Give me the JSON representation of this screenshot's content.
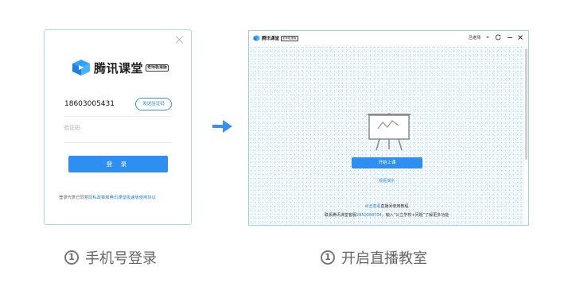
{
  "login_panel": {
    "brand": "腾讯课堂",
    "brand_badge": "老师极速版",
    "phone_value": "18603005431",
    "send_code_label": "发送验证码",
    "code_placeholder": "验证码",
    "login_label": "登 录",
    "agreement_prefix": "登录代表已同意",
    "agreement_link_privacy": "隐私政策",
    "agreement_and": "和",
    "agreement_link_terms": "腾讯课堂极速版使用协议"
  },
  "caption_left": {
    "number": "1",
    "text": "手机号登录"
  },
  "caption_right": {
    "number": "1",
    "text": "开启直播教室"
  },
  "classroom_window": {
    "title": "腾讯课堂",
    "title_badge": "老师极速版",
    "user_name": "吕老师",
    "start_button": "开始上课",
    "guide_link": "观看演示",
    "help_line1_link": "点击查看",
    "help_line1_text": "直播间使用教程",
    "help_line2_prefix": "联系腾讯课堂客服",
    "help_line2_link": "2850008704",
    "help_line2_suffix": "，输入“公立学校+问题”了解更多功能"
  },
  "colors": {
    "accent_blue": "#2e8ff0",
    "link_blue": "#2e86dd",
    "panel_border": "#a9d3f3"
  },
  "icons": [
    "close-icon",
    "tencent-classroom-logo-icon",
    "arrow-right-icon",
    "refresh-icon",
    "minimize-icon",
    "whiteboard-icon",
    "chevron-down-icon"
  ]
}
